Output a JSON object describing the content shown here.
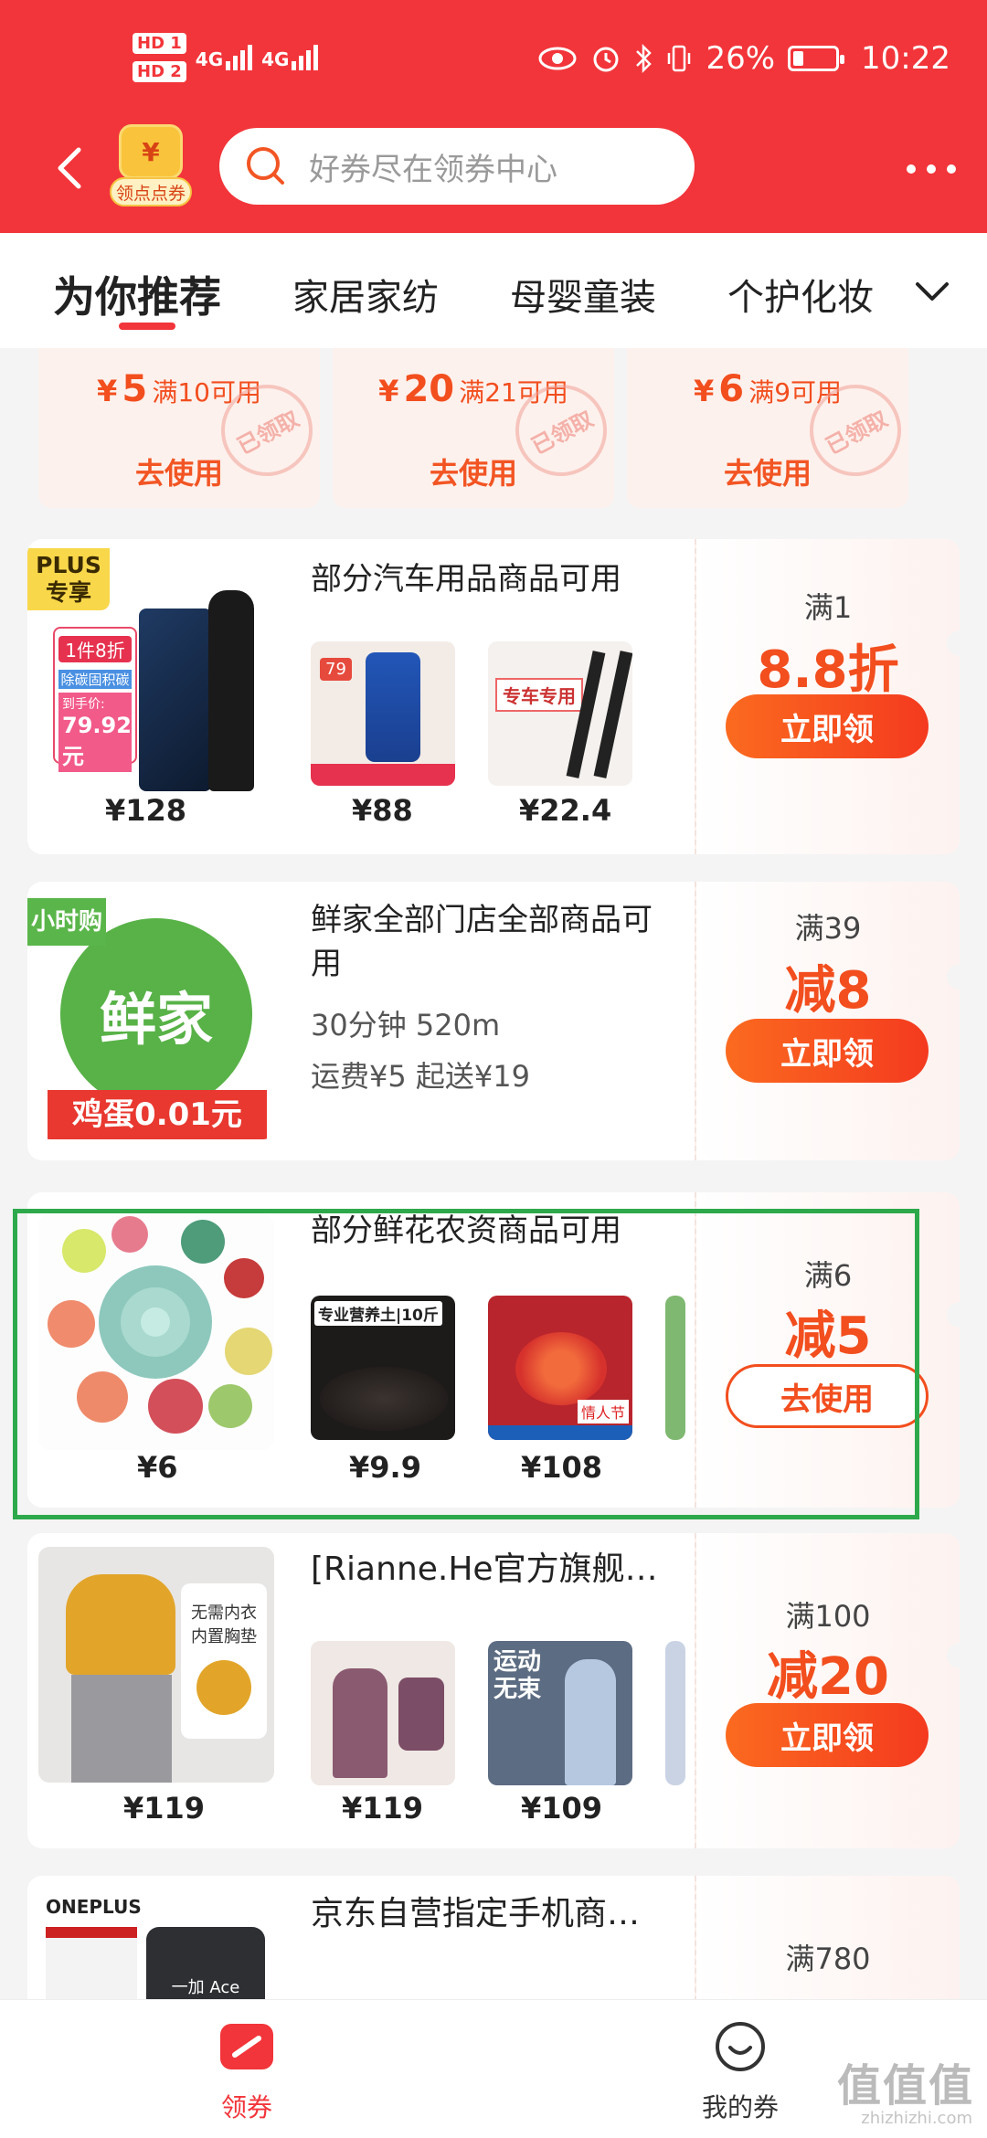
{
  "status": {
    "hd1": "HD 1",
    "hd2": "HD 2",
    "net1": "4G",
    "net2": "4G",
    "battery_text": "26%",
    "battery_level": 0.26,
    "time": "10:22"
  },
  "header": {
    "badge_symbol": "¥",
    "badge_label": "领点点券",
    "search_placeholder": "好券尽在领券中心"
  },
  "tabs": [
    "为你推荐",
    "家居家纺",
    "母婴童装",
    "个护化妆"
  ],
  "top_coupons": [
    {
      "symbol": "¥",
      "amount": "5",
      "cond": "满10可用",
      "action": "去使用",
      "stamp": "已领取"
    },
    {
      "symbol": "¥",
      "amount": "20",
      "cond": "满21可用",
      "action": "去使用",
      "stamp": "已领取"
    },
    {
      "symbol": "¥",
      "amount": "6",
      "cond": "满9可用",
      "action": "去使用",
      "stamp": "已领取"
    }
  ],
  "cards": [
    {
      "tag": "PLUS\n专享",
      "title": "部分汽车用品商品可用",
      "prices": [
        "¥128",
        "¥88",
        "¥22.4"
      ],
      "cond": "满1",
      "value": "8.8折",
      "button": "立即领",
      "promo_a": "1件8折",
      "promo_b": "除碳固积碳",
      "promo_c": "到手价:",
      "promo_price": "79.92 元",
      "thumb2_text": "79",
      "thumb3_text": "专车专用"
    },
    {
      "tag": "小时购",
      "title": "鲜家全部门店全部商品可用",
      "logo": "鲜家",
      "banner": "鸡蛋0.01元",
      "info1": "30分钟   520m",
      "info2": "运费¥5   起送¥19",
      "cond": "满39",
      "value": "减8",
      "button": "立即领"
    },
    {
      "title": "部分鲜花农资商品可用",
      "prices": [
        "¥6",
        "¥9.9",
        "¥108"
      ],
      "thumb1_text": "专业营养土|10斤",
      "thumb2_text": "情人节",
      "cond": "满6",
      "value": "减5",
      "button": "去使用"
    },
    {
      "title": "[Rianne.He官方旗舰…",
      "prices": [
        "¥119",
        "¥119",
        "¥109"
      ],
      "promo_a": "无需内衣",
      "promo_b": "内置胸垫",
      "thumb2_text": "运动 无束",
      "cond": "满100",
      "value": "减20",
      "button": "立即领"
    },
    {
      "title": "京东自营指定手机商…",
      "brand": "ONEPLUS",
      "phone_label": "一加 Ace",
      "cond": "满780"
    }
  ],
  "bottom_nav": [
    {
      "label": "领券"
    },
    {
      "label": "我的券"
    }
  ],
  "watermark": "值值值",
  "watermark_sub": "zhizhizhi.com",
  "colors": {
    "brand_red": "#f2353a",
    "accent_orange": "#f24e1e",
    "highlight_green": "#2da94b"
  }
}
